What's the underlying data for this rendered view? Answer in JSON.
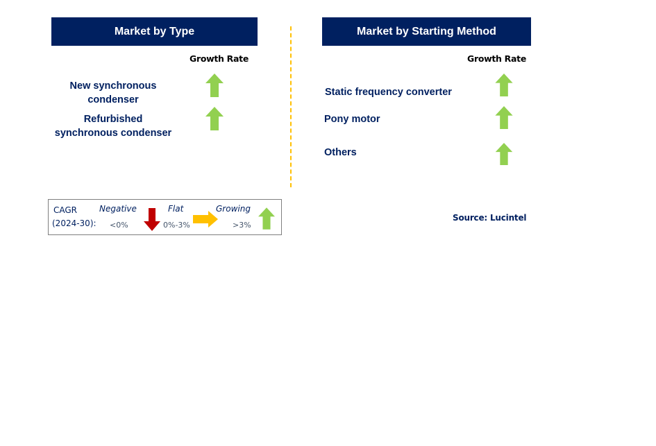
{
  "colors": {
    "header_bg": "#002060",
    "header_text": "#FFFFFF",
    "label_text": "#002060",
    "up_arrow": "#92D050",
    "down_arrow": "#C00000",
    "flat_arrow": "#FFC000",
    "divider": "#FFC000"
  },
  "left_panel": {
    "title": "Market by Type",
    "growth_header": "Growth Rate",
    "segments": [
      {
        "line1": "New synchronous",
        "line2": "condenser",
        "trend": "growing",
        "icon": "up-arrow-icon"
      },
      {
        "line1": "Refurbished",
        "line2": "synchronous condenser",
        "trend": "growing",
        "icon": "up-arrow-icon"
      }
    ]
  },
  "right_panel": {
    "title": "Market by Starting Method",
    "growth_header": "Growth Rate",
    "segments": [
      {
        "label": "Static frequency converter",
        "trend": "growing",
        "icon": "up-arrow-icon"
      },
      {
        "label": "Pony motor",
        "trend": "growing",
        "icon": "up-arrow-icon"
      },
      {
        "label": "Others",
        "trend": "growing",
        "icon": "up-arrow-icon"
      }
    ]
  },
  "legend": {
    "cagr_label": "CAGR",
    "period_label": "(2024-30):",
    "items": [
      {
        "name": "Negative",
        "range": "<0%",
        "icon": "down-arrow-icon"
      },
      {
        "name": "Flat",
        "range": "0%-3%",
        "icon": "right-arrow-icon"
      },
      {
        "name": "Growing",
        "range": ">3%",
        "icon": "up-arrow-icon"
      }
    ]
  },
  "source": "Source: Lucintel"
}
